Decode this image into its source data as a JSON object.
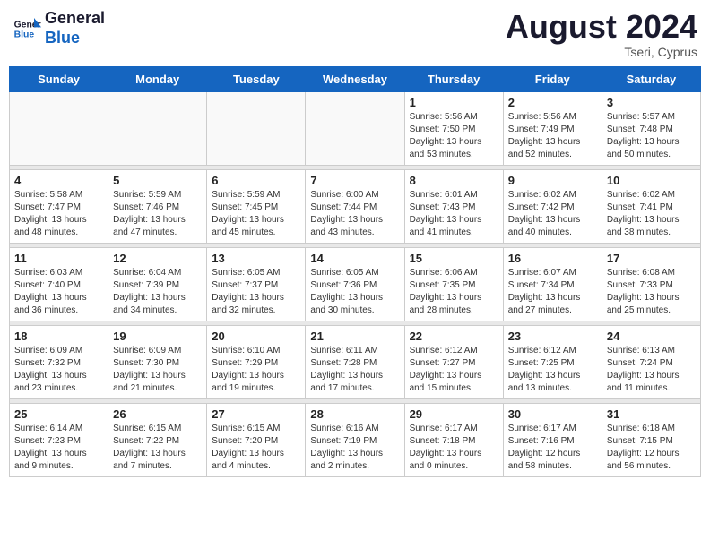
{
  "header": {
    "logo_line1": "General",
    "logo_line2": "Blue",
    "month_title": "August 2024",
    "location": "Tseri, Cyprus"
  },
  "weekdays": [
    "Sunday",
    "Monday",
    "Tuesday",
    "Wednesday",
    "Thursday",
    "Friday",
    "Saturday"
  ],
  "weeks": [
    [
      {
        "day": "",
        "info": ""
      },
      {
        "day": "",
        "info": ""
      },
      {
        "day": "",
        "info": ""
      },
      {
        "day": "",
        "info": ""
      },
      {
        "day": "1",
        "info": "Sunrise: 5:56 AM\nSunset: 7:50 PM\nDaylight: 13 hours\nand 53 minutes."
      },
      {
        "day": "2",
        "info": "Sunrise: 5:56 AM\nSunset: 7:49 PM\nDaylight: 13 hours\nand 52 minutes."
      },
      {
        "day": "3",
        "info": "Sunrise: 5:57 AM\nSunset: 7:48 PM\nDaylight: 13 hours\nand 50 minutes."
      }
    ],
    [
      {
        "day": "4",
        "info": "Sunrise: 5:58 AM\nSunset: 7:47 PM\nDaylight: 13 hours\nand 48 minutes."
      },
      {
        "day": "5",
        "info": "Sunrise: 5:59 AM\nSunset: 7:46 PM\nDaylight: 13 hours\nand 47 minutes."
      },
      {
        "day": "6",
        "info": "Sunrise: 5:59 AM\nSunset: 7:45 PM\nDaylight: 13 hours\nand 45 minutes."
      },
      {
        "day": "7",
        "info": "Sunrise: 6:00 AM\nSunset: 7:44 PM\nDaylight: 13 hours\nand 43 minutes."
      },
      {
        "day": "8",
        "info": "Sunrise: 6:01 AM\nSunset: 7:43 PM\nDaylight: 13 hours\nand 41 minutes."
      },
      {
        "day": "9",
        "info": "Sunrise: 6:02 AM\nSunset: 7:42 PM\nDaylight: 13 hours\nand 40 minutes."
      },
      {
        "day": "10",
        "info": "Sunrise: 6:02 AM\nSunset: 7:41 PM\nDaylight: 13 hours\nand 38 minutes."
      }
    ],
    [
      {
        "day": "11",
        "info": "Sunrise: 6:03 AM\nSunset: 7:40 PM\nDaylight: 13 hours\nand 36 minutes."
      },
      {
        "day": "12",
        "info": "Sunrise: 6:04 AM\nSunset: 7:39 PM\nDaylight: 13 hours\nand 34 minutes."
      },
      {
        "day": "13",
        "info": "Sunrise: 6:05 AM\nSunset: 7:37 PM\nDaylight: 13 hours\nand 32 minutes."
      },
      {
        "day": "14",
        "info": "Sunrise: 6:05 AM\nSunset: 7:36 PM\nDaylight: 13 hours\nand 30 minutes."
      },
      {
        "day": "15",
        "info": "Sunrise: 6:06 AM\nSunset: 7:35 PM\nDaylight: 13 hours\nand 28 minutes."
      },
      {
        "day": "16",
        "info": "Sunrise: 6:07 AM\nSunset: 7:34 PM\nDaylight: 13 hours\nand 27 minutes."
      },
      {
        "day": "17",
        "info": "Sunrise: 6:08 AM\nSunset: 7:33 PM\nDaylight: 13 hours\nand 25 minutes."
      }
    ],
    [
      {
        "day": "18",
        "info": "Sunrise: 6:09 AM\nSunset: 7:32 PM\nDaylight: 13 hours\nand 23 minutes."
      },
      {
        "day": "19",
        "info": "Sunrise: 6:09 AM\nSunset: 7:30 PM\nDaylight: 13 hours\nand 21 minutes."
      },
      {
        "day": "20",
        "info": "Sunrise: 6:10 AM\nSunset: 7:29 PM\nDaylight: 13 hours\nand 19 minutes."
      },
      {
        "day": "21",
        "info": "Sunrise: 6:11 AM\nSunset: 7:28 PM\nDaylight: 13 hours\nand 17 minutes."
      },
      {
        "day": "22",
        "info": "Sunrise: 6:12 AM\nSunset: 7:27 PM\nDaylight: 13 hours\nand 15 minutes."
      },
      {
        "day": "23",
        "info": "Sunrise: 6:12 AM\nSunset: 7:25 PM\nDaylight: 13 hours\nand 13 minutes."
      },
      {
        "day": "24",
        "info": "Sunrise: 6:13 AM\nSunset: 7:24 PM\nDaylight: 13 hours\nand 11 minutes."
      }
    ],
    [
      {
        "day": "25",
        "info": "Sunrise: 6:14 AM\nSunset: 7:23 PM\nDaylight: 13 hours\nand 9 minutes."
      },
      {
        "day": "26",
        "info": "Sunrise: 6:15 AM\nSunset: 7:22 PM\nDaylight: 13 hours\nand 7 minutes."
      },
      {
        "day": "27",
        "info": "Sunrise: 6:15 AM\nSunset: 7:20 PM\nDaylight: 13 hours\nand 4 minutes."
      },
      {
        "day": "28",
        "info": "Sunrise: 6:16 AM\nSunset: 7:19 PM\nDaylight: 13 hours\nand 2 minutes."
      },
      {
        "day": "29",
        "info": "Sunrise: 6:17 AM\nSunset: 7:18 PM\nDaylight: 13 hours\nand 0 minutes."
      },
      {
        "day": "30",
        "info": "Sunrise: 6:17 AM\nSunset: 7:16 PM\nDaylight: 12 hours\nand 58 minutes."
      },
      {
        "day": "31",
        "info": "Sunrise: 6:18 AM\nSunset: 7:15 PM\nDaylight: 12 hours\nand 56 minutes."
      }
    ]
  ]
}
